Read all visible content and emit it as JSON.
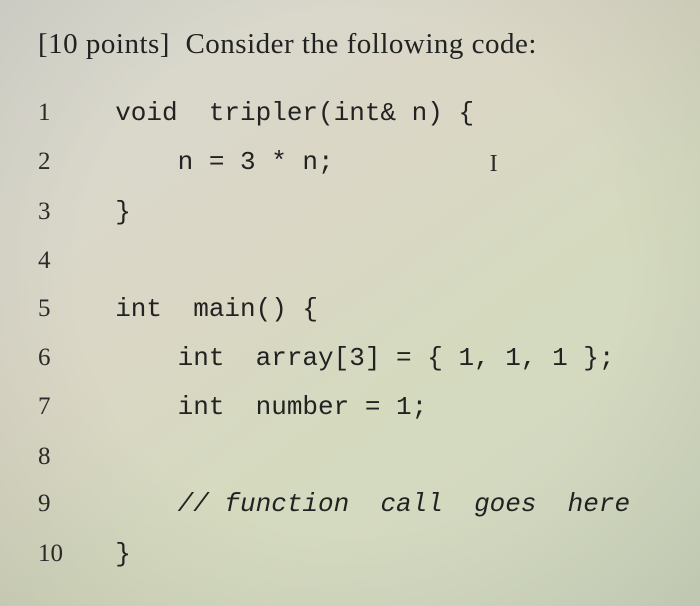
{
  "header": {
    "points_prefix": "[10 points]",
    "prompt": "Consider the following code:"
  },
  "code": {
    "lines": [
      {
        "n": "1",
        "text": "  void  tripler(int& n) {"
      },
      {
        "n": "2",
        "text": "      n = 3 * n;          ",
        "cursor": true
      },
      {
        "n": "3",
        "text": "  }"
      },
      {
        "n": "4",
        "text": ""
      },
      {
        "n": "5",
        "text": "  int  main() {"
      },
      {
        "n": "6",
        "text": "      int  array[3] = { 1, 1, 1 };"
      },
      {
        "n": "7",
        "text": "      int  number = 1;"
      },
      {
        "n": "8",
        "text": ""
      },
      {
        "n": "9",
        "text": "      // function  call  goes  here",
        "comment": true
      },
      {
        "n": "10",
        "text": "  }"
      }
    ]
  },
  "cursor_glyph": "I"
}
